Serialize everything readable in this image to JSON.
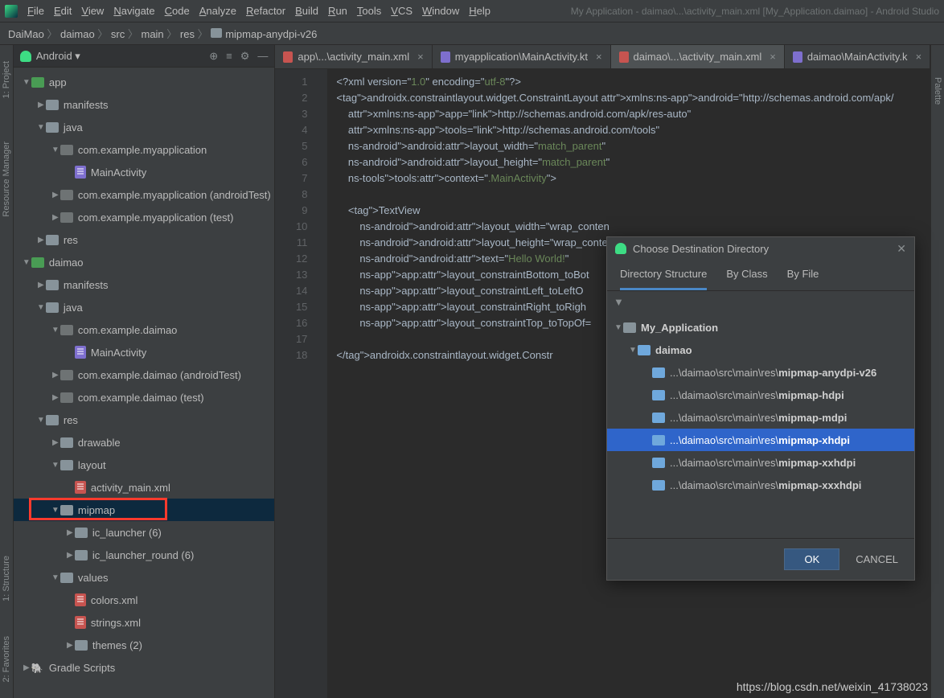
{
  "menu": [
    "File",
    "Edit",
    "View",
    "Navigate",
    "Code",
    "Analyze",
    "Refactor",
    "Build",
    "Run",
    "Tools",
    "VCS",
    "Window",
    "Help"
  ],
  "app_title": "My Application - daimao\\...\\activity_main.xml [My_Application.daimao] - Android Studio",
  "breadcrumbs": [
    "DaiMao",
    "daimao",
    "src",
    "main",
    "res",
    "mipmap-anydpi-v26"
  ],
  "sidebar": {
    "header": "Android",
    "tree": [
      {
        "d": 0,
        "a": "▼",
        "ico": "mod",
        "lbl": "app"
      },
      {
        "d": 1,
        "a": "▶",
        "ico": "fold",
        "lbl": "manifests"
      },
      {
        "d": 1,
        "a": "▼",
        "ico": "fold",
        "lbl": "java"
      },
      {
        "d": 2,
        "a": "▼",
        "ico": "pkg",
        "lbl": "com.example.myapplication"
      },
      {
        "d": 3,
        "a": "",
        "ico": "kt",
        "lbl": "MainActivity"
      },
      {
        "d": 2,
        "a": "▶",
        "ico": "pkg",
        "lbl": "com.example.myapplication (androidTest)"
      },
      {
        "d": 2,
        "a": "▶",
        "ico": "pkg",
        "lbl": "com.example.myapplication (test)"
      },
      {
        "d": 1,
        "a": "▶",
        "ico": "fold",
        "lbl": "res"
      },
      {
        "d": 0,
        "a": "▼",
        "ico": "mod",
        "lbl": "daimao"
      },
      {
        "d": 1,
        "a": "▶",
        "ico": "fold",
        "lbl": "manifests"
      },
      {
        "d": 1,
        "a": "▼",
        "ico": "fold",
        "lbl": "java"
      },
      {
        "d": 2,
        "a": "▼",
        "ico": "pkg",
        "lbl": "com.example.daimao"
      },
      {
        "d": 3,
        "a": "",
        "ico": "kt",
        "lbl": "MainActivity"
      },
      {
        "d": 2,
        "a": "▶",
        "ico": "pkg",
        "lbl": "com.example.daimao (androidTest)"
      },
      {
        "d": 2,
        "a": "▶",
        "ico": "pkg",
        "lbl": "com.example.daimao (test)"
      },
      {
        "d": 1,
        "a": "▼",
        "ico": "fold",
        "lbl": "res"
      },
      {
        "d": 2,
        "a": "▶",
        "ico": "fold",
        "lbl": "drawable"
      },
      {
        "d": 2,
        "a": "▼",
        "ico": "fold",
        "lbl": "layout"
      },
      {
        "d": 3,
        "a": "",
        "ico": "xml",
        "lbl": "activity_main.xml"
      },
      {
        "d": 2,
        "a": "▼",
        "ico": "fold",
        "lbl": "mipmap",
        "sel": true
      },
      {
        "d": 3,
        "a": "▶",
        "ico": "fold",
        "lbl": "ic_launcher (6)"
      },
      {
        "d": 3,
        "a": "▶",
        "ico": "fold",
        "lbl": "ic_launcher_round (6)"
      },
      {
        "d": 2,
        "a": "▼",
        "ico": "fold",
        "lbl": "values"
      },
      {
        "d": 3,
        "a": "",
        "ico": "xml",
        "lbl": "colors.xml"
      },
      {
        "d": 3,
        "a": "",
        "ico": "xml",
        "lbl": "strings.xml"
      },
      {
        "d": 3,
        "a": "▶",
        "ico": "fold",
        "lbl": "themes (2)"
      },
      {
        "d": 0,
        "a": "▶",
        "ico": "gradle",
        "lbl": "Gradle Scripts"
      }
    ]
  },
  "tabs": [
    {
      "lbl": "app\\...\\activity_main.xml",
      "ico": "xml",
      "active": false
    },
    {
      "lbl": "myapplication\\MainActivity.kt",
      "ico": "kt",
      "active": false
    },
    {
      "lbl": "daimao\\...\\activity_main.xml",
      "ico": "xml",
      "active": true
    },
    {
      "lbl": "daimao\\MainActivity.k",
      "ico": "kt",
      "active": false
    }
  ],
  "code": {
    "lines": [
      1,
      2,
      3,
      4,
      5,
      6,
      7,
      8,
      9,
      10,
      11,
      12,
      13,
      14,
      15,
      16,
      17,
      18
    ],
    "raw": "<?xml version=\"1.0\" encoding=\"utf-8\"?>\n<androidx.constraintlayout.widget.ConstraintLayout xmlns:android=\"http://schemas.android.com/apk/\n    xmlns:app=\"http://schemas.android.com/apk/res-auto\"\n    xmlns:tools=\"http://schemas.android.com/tools\"\n    android:layout_width=\"match_parent\"\n    android:layout_height=\"match_parent\"\n    tools:context=\".MainActivity\">\n\n    <TextView\n        android:layout_width=\"wrap_conten\n        android:layout_height=\"wrap_conte\n        android:text=\"Hello World!\"\n        app:layout_constraintBottom_toBot\n        app:layout_constraintLeft_toLeftO\n        app:layout_constraintRight_toRigh\n        app:layout_constraintTop_toTopOf=\n\n</androidx.constraintlayout.widget.Constr"
  },
  "dialog": {
    "title": "Choose Destination Directory",
    "tabs": [
      "Directory Structure",
      "By Class",
      "By File"
    ],
    "active_tab": 0,
    "tree": [
      {
        "d": 0,
        "a": "▼",
        "ico": "prj",
        "pfx": "",
        "bold": "My_Application"
      },
      {
        "d": 1,
        "a": "▼",
        "ico": "mod",
        "pfx": "",
        "bold": "daimao"
      },
      {
        "d": 2,
        "a": "",
        "ico": "fold",
        "pfx": "...\\daimao\\src\\main\\res\\",
        "bold": "mipmap-anydpi-v26"
      },
      {
        "d": 2,
        "a": "",
        "ico": "fold",
        "pfx": "...\\daimao\\src\\main\\res\\",
        "bold": "mipmap-hdpi"
      },
      {
        "d": 2,
        "a": "",
        "ico": "fold",
        "pfx": "...\\daimao\\src\\main\\res\\",
        "bold": "mipmap-mdpi"
      },
      {
        "d": 2,
        "a": "",
        "ico": "fold",
        "pfx": "...\\daimao\\src\\main\\res\\",
        "bold": "mipmap-xhdpi",
        "sel": true
      },
      {
        "d": 2,
        "a": "",
        "ico": "fold",
        "pfx": "...\\daimao\\src\\main\\res\\",
        "bold": "mipmap-xxhdpi"
      },
      {
        "d": 2,
        "a": "",
        "ico": "fold",
        "pfx": "...\\daimao\\src\\main\\res\\",
        "bold": "mipmap-xxxhdpi"
      }
    ],
    "ok": "OK",
    "cancel": "CANCEL"
  },
  "left_tools": [
    "1: Project",
    "Resource Manager"
  ],
  "right_tool": "Palette",
  "bottom_tools": [
    "2: Favorites",
    "1: Structure"
  ],
  "watermark": "https://blog.csdn.net/weixin_41738023"
}
